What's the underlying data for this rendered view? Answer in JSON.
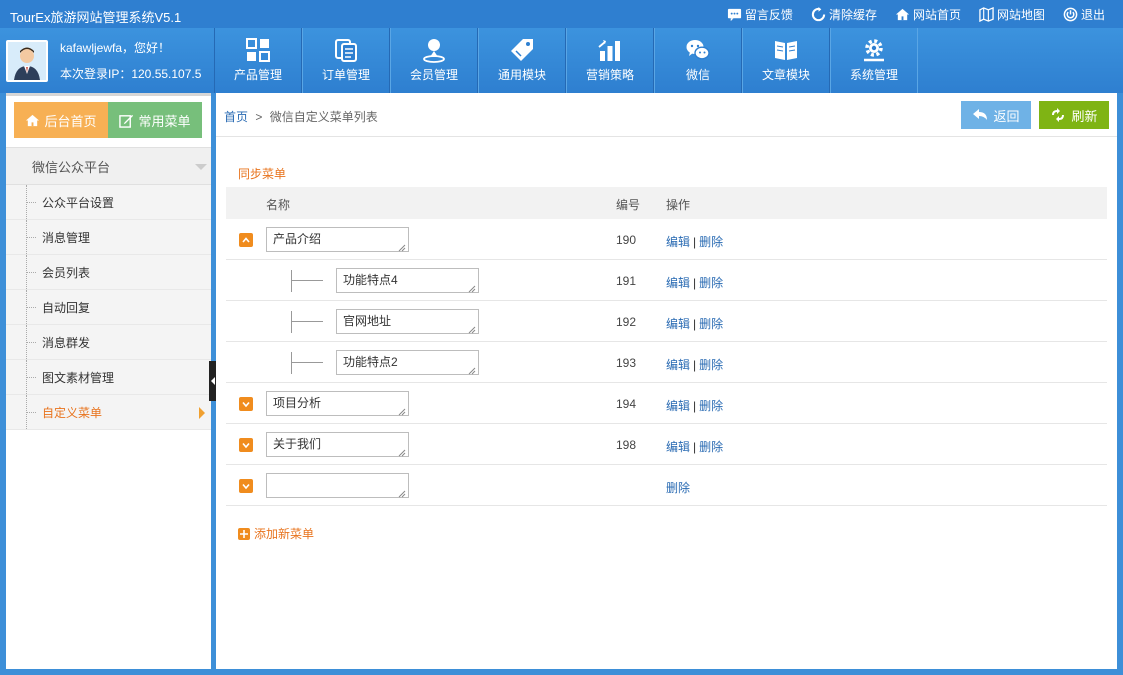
{
  "app": {
    "title": "TourEx旅游网站管理系统V5.1"
  },
  "top_links": [
    {
      "label": "留言反馈",
      "icon": "chat-icon"
    },
    {
      "label": "清除缓存",
      "icon": "refresh-icon"
    },
    {
      "label": "网站首页",
      "icon": "home-icon"
    },
    {
      "label": "网站地图",
      "icon": "map-icon"
    },
    {
      "label": "退出",
      "icon": "power-icon"
    }
  ],
  "user": {
    "greeting": "kafawljewfa，您好！",
    "login_ip": "本次登录IP：120.55.107.5"
  },
  "modules": [
    {
      "label": "产品管理",
      "icon": "grid-icon"
    },
    {
      "label": "订单管理",
      "icon": "documents-icon"
    },
    {
      "label": "会员管理",
      "icon": "user-pin-icon"
    },
    {
      "label": "通用模块",
      "icon": "tag-icon"
    },
    {
      "label": "营销策略",
      "icon": "bar-chart-icon"
    },
    {
      "label": "微信",
      "icon": "wechat-icon"
    },
    {
      "label": "文章模块",
      "icon": "book-icon"
    },
    {
      "label": "系统管理",
      "icon": "gear-icon"
    }
  ],
  "sidebar": {
    "home_btn": "后台首页",
    "common_btn": "常用菜单",
    "section": "微信公众平台",
    "items": [
      {
        "label": "公众平台设置"
      },
      {
        "label": "消息管理"
      },
      {
        "label": "会员列表"
      },
      {
        "label": "自动回复"
      },
      {
        "label": "消息群发"
      },
      {
        "label": "图文素材管理"
      },
      {
        "label": "自定义菜单"
      }
    ],
    "active_item": "自定义菜单"
  },
  "breadcrumb": {
    "home": "首页",
    "sep": ">",
    "current": "微信自定义菜单列表"
  },
  "actions": {
    "back": "返回",
    "refresh": "刷新"
  },
  "sync_label": "同步菜单",
  "table": {
    "headers": {
      "name": "名称",
      "id": "编号",
      "ops": "操作"
    },
    "edit_label": "编辑",
    "delete_label": "删除",
    "op_sep": "|",
    "rows": [
      {
        "name": "产品介绍",
        "id": "190",
        "level": "top",
        "expanded": true
      },
      {
        "name": "功能特点4",
        "id": "191",
        "level": "sub"
      },
      {
        "name": "官网地址",
        "id": "192",
        "level": "sub"
      },
      {
        "name": "功能特点2",
        "id": "193",
        "level": "sub"
      },
      {
        "name": "项目分析",
        "id": "194",
        "level": "top",
        "expanded": false
      },
      {
        "name": "关于我们",
        "id": "198",
        "level": "top",
        "expanded": false
      },
      {
        "name": "",
        "id": "",
        "level": "top",
        "expanded": false
      }
    ]
  },
  "add_label": "添加新菜单",
  "colors": {
    "brand_blue": "#2f7fd0",
    "accent_orange": "#e8741e",
    "refresh_green": "#7fb414",
    "back_blue": "#6fb2e6",
    "link_blue": "#2a6bb3"
  }
}
